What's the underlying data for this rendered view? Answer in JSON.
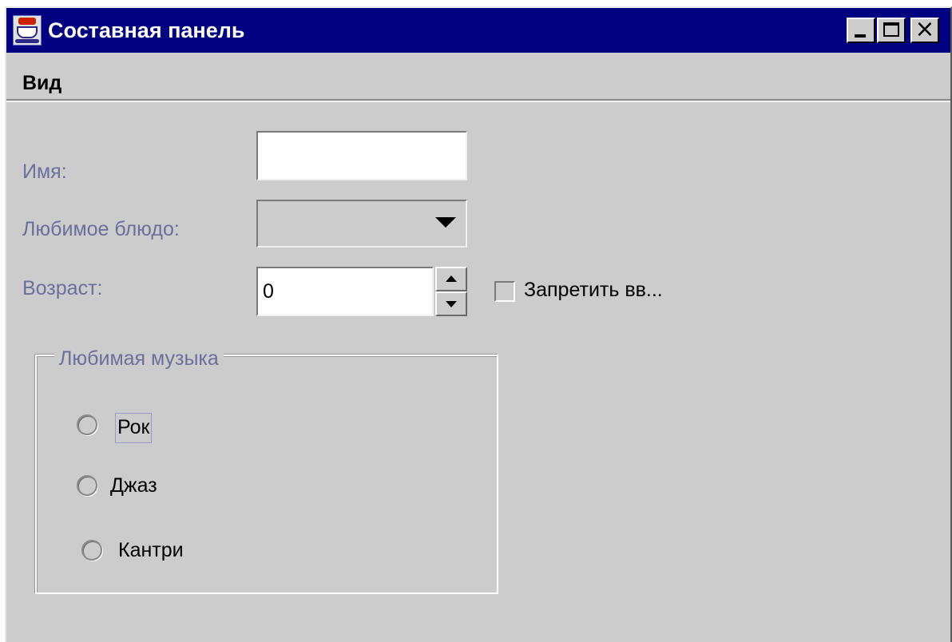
{
  "window": {
    "title": "Составная панель",
    "icon": "java-coffee-cup-icon",
    "controls": {
      "minimize": "_",
      "maximize": "□",
      "close": "×"
    }
  },
  "menubar": {
    "items": [
      "Вид"
    ]
  },
  "form": {
    "name_label": "Имя:",
    "name_value": "",
    "dish_label": "Любимое блюдо:",
    "dish_value": "",
    "age_label": "Возраст:",
    "age_value": "0",
    "disable_checkbox_label": "Запретить вв...",
    "disable_checked": false
  },
  "music_group": {
    "title": "Любимая музыка",
    "options": [
      {
        "label": "Рок",
        "selected": false,
        "focused": true
      },
      {
        "label": "Джаз",
        "selected": false,
        "focused": false
      },
      {
        "label": "Кантри",
        "selected": false,
        "focused": false
      }
    ]
  },
  "colors": {
    "titlebar": "#000080",
    "panel": "#cccccc",
    "disabled_label": "#6b6f9c"
  }
}
